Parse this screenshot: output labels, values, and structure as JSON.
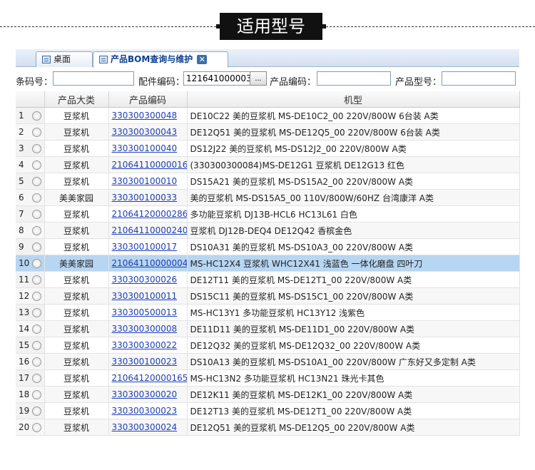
{
  "banner": {
    "title": "适用型号"
  },
  "tabs": [
    {
      "label": "桌面",
      "icon": "window-icon"
    },
    {
      "label": "产品BOM查询与维护",
      "icon": "window-icon",
      "close_label": "✕"
    }
  ],
  "search": {
    "barcode_label": "条码号：",
    "barcode_value": "",
    "part_code_label": "配件编码：",
    "part_code_value": "121641000003(",
    "picker_label": "...",
    "product_code_label": "产品编码：",
    "product_code_value": "",
    "product_model_label": "产品型号：",
    "product_model_value": ""
  },
  "grid": {
    "headers": [
      "",
      "产品大类",
      "产品编码",
      "机型"
    ],
    "selected_row": 10,
    "rows": [
      {
        "num": "1",
        "category": "豆浆机",
        "code": "330300300048",
        "model": "DE10C22 美的豆浆机 MS-DE10C2_00 220V/800W 6台装 A类"
      },
      {
        "num": "2",
        "category": "豆浆机",
        "code": "330300300043",
        "model": "DE12Q51 美的豆浆机 MS-DE12Q5_00 220V/800W 6台装 A类"
      },
      {
        "num": "3",
        "category": "豆浆机",
        "code": "330300100040",
        "model": "DS12J22 美的豆浆机 MS-DS12J2_00 220V/800W A类"
      },
      {
        "num": "4",
        "category": "豆浆机",
        "code": "21064110000016",
        "model": "(330300300084)MS-DE12G1 豆浆机 DE12G13 红色"
      },
      {
        "num": "5",
        "category": "豆浆机",
        "code": "330300100010",
        "model": "DS15A21 美的豆浆机 MS-DS15A2_00 220V/800W A类"
      },
      {
        "num": "6",
        "category": "美美家园",
        "code": "330300100033",
        "model": "美的豆浆机 MS-DS15A5_00 110V/800W/60HZ 台湾康洋 A类"
      },
      {
        "num": "7",
        "category": "豆浆机",
        "code": "21064120000286",
        "model": "多功能豆浆机 DJ13B-HCL6 HC13L61 白色"
      },
      {
        "num": "8",
        "category": "豆浆机",
        "code": "21064110000240",
        "model": "豆浆机 DJ12B-DEQ4 DE12Q42 香槟金色"
      },
      {
        "num": "9",
        "category": "豆浆机",
        "code": "330300100017",
        "model": "DS10A31 美的豆浆机 MS-DS10A3_00 220V/800W A类"
      },
      {
        "num": "10",
        "category": "美美家园",
        "code": "21064110000004",
        "model": "MS-HC12X4 豆浆机 WHC12X41 浅蓝色 一体化磨盘 四叶刀"
      },
      {
        "num": "11",
        "category": "豆浆机",
        "code": "330300300026",
        "model": "DE12T11 美的豆浆机 MS-DE12T1_00 220V/800W A类"
      },
      {
        "num": "12",
        "category": "豆浆机",
        "code": "330300100011",
        "model": "DS15C11 美的豆浆机 MS-DS15C1_00 220V/800W A类"
      },
      {
        "num": "13",
        "category": "豆浆机",
        "code": "330300500013",
        "model": "MS-HC13Y1 多功能豆浆机 HC13Y12 浅紫色"
      },
      {
        "num": "14",
        "category": "豆浆机",
        "code": "330300300008",
        "model": "DE11D11 美的豆浆机 MS-DE11D1_00 220V/800W A类"
      },
      {
        "num": "15",
        "category": "豆浆机",
        "code": "330300300022",
        "model": "DE12Q32 美的豆浆机 MS-DE12Q32_00 220V/800W A类"
      },
      {
        "num": "16",
        "category": "豆浆机",
        "code": "330300100023",
        "model": "DS10A13 美的豆浆机 MS-DS10A1_00 220V/800W 广东好又多定制 A类"
      },
      {
        "num": "17",
        "category": "豆浆机",
        "code": "21064120000165",
        "model": "MS-HC13N2 多功能豆浆机 HC13N21 珠光卡其色"
      },
      {
        "num": "18",
        "category": "豆浆机",
        "code": "330300300020",
        "model": "DE12K11 美的豆浆机 MS-DE12K1_00 220V/800W A类"
      },
      {
        "num": "19",
        "category": "豆浆机",
        "code": "330300300023",
        "model": "DE12T13 美的豆浆机 MS-DE12T1_00 220V/800W A类"
      },
      {
        "num": "20",
        "category": "豆浆机",
        "code": "330300300024",
        "model": "DE12Q51 美的豆浆机 MS-DE12Q5_00 220V/800W A类"
      }
    ]
  },
  "colors": {
    "selected_row": "#b7d6f2",
    "link": "#1f3fb5",
    "banner_bg": "#111111"
  }
}
